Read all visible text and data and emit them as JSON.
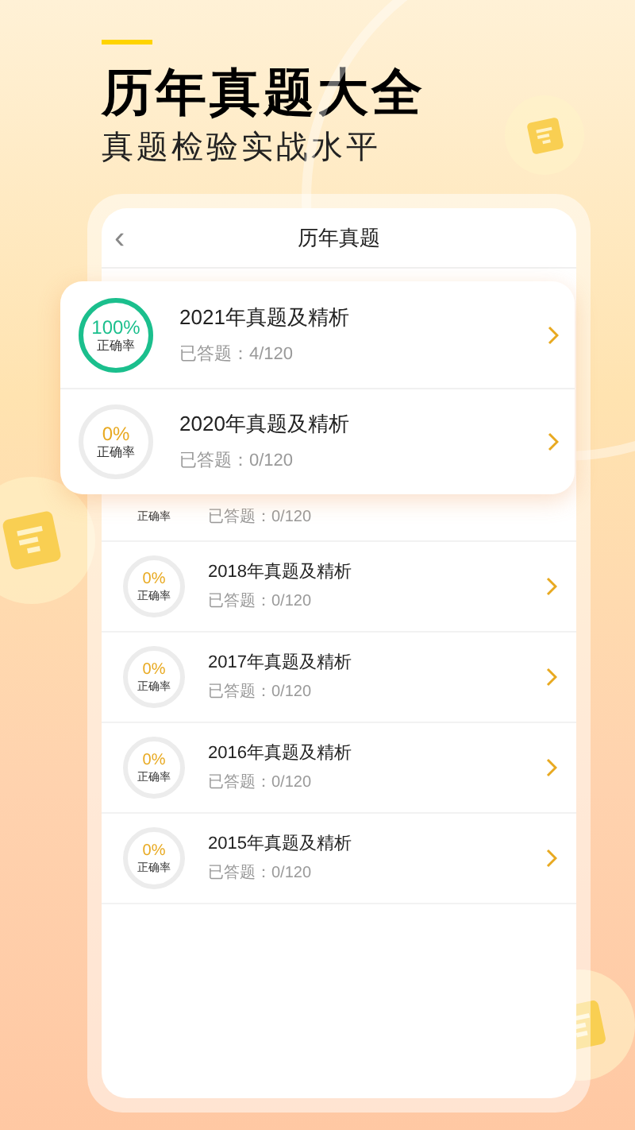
{
  "headline": {
    "title": "历年真题大全",
    "subtitle": "真题检验实战水平"
  },
  "screen": {
    "back_icon": "‹",
    "title": "历年真题"
  },
  "highlight_card": [
    {
      "accuracy": "100%",
      "accuracy_label": "正确率",
      "completed": true,
      "title": "2021年真题及精析",
      "answered": "已答题：4/120"
    },
    {
      "accuracy": "0%",
      "accuracy_label": "正确率",
      "completed": false,
      "title": "2020年真题及精析",
      "answered": "已答题：0/120"
    }
  ],
  "list": [
    {
      "kind": "partial",
      "accuracy_label": "正确率",
      "answered": "已答题：0/120"
    },
    {
      "kind": "full",
      "accuracy": "0%",
      "accuracy_label": "正确率",
      "completed": false,
      "title": "2018年真题及精析",
      "answered": "已答题：0/120"
    },
    {
      "kind": "full",
      "accuracy": "0%",
      "accuracy_label": "正确率",
      "completed": false,
      "title": "2017年真题及精析",
      "answered": "已答题：0/120"
    },
    {
      "kind": "full",
      "accuracy": "0%",
      "accuracy_label": "正确率",
      "completed": false,
      "title": "2016年真题及精析",
      "answered": "已答题：0/120"
    },
    {
      "kind": "full",
      "accuracy": "0%",
      "accuracy_label": "正确率",
      "completed": false,
      "title": "2015年真题及精析",
      "answered": "已答题：0/120"
    }
  ]
}
